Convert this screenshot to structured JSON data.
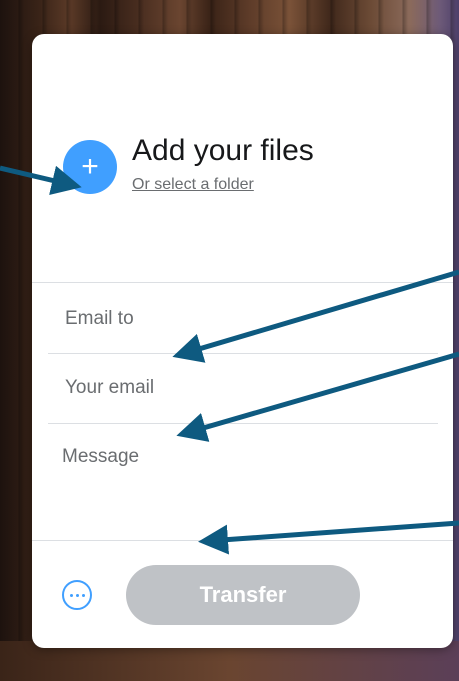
{
  "upload": {
    "title": "Add your files",
    "folder_link": "Or select a folder",
    "add_icon": "plus-icon"
  },
  "form": {
    "email_to_placeholder": "Email to",
    "your_email_placeholder": "Your email",
    "message_placeholder": "Message"
  },
  "footer": {
    "more_icon": "more-options-icon",
    "transfer_label": "Transfer"
  },
  "colors": {
    "accent": "#409fff",
    "button_disabled": "#bfc2c6",
    "annotation_arrow": "#0e5a80"
  }
}
